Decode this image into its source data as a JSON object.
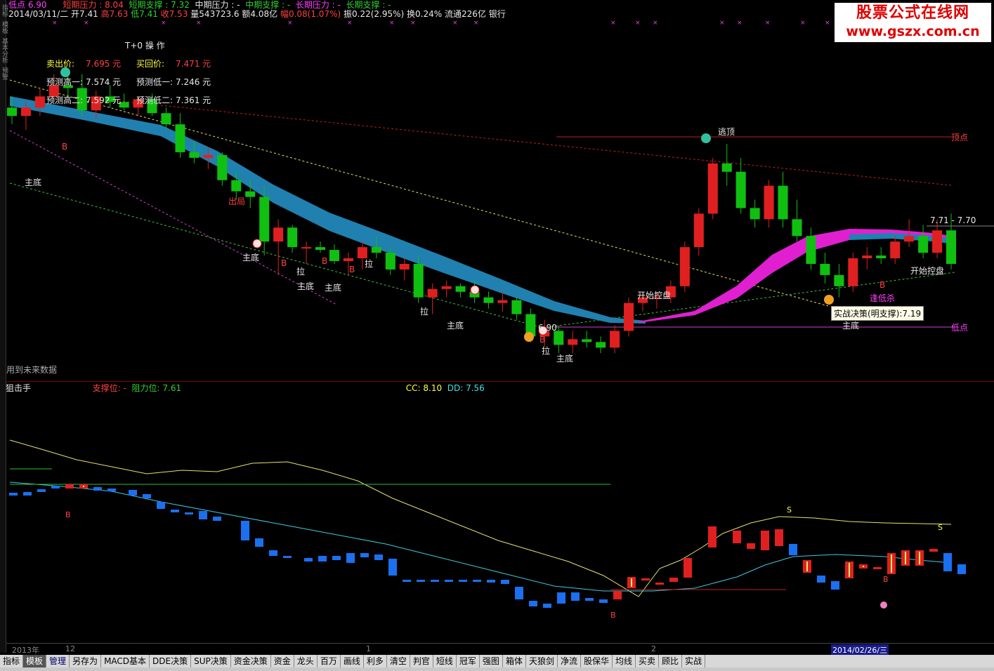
{
  "side": [
    "指标",
    "模板",
    "基本分析",
    "预警"
  ],
  "header1": {
    "lowpt": "低点 6.90",
    "short_res": "短期压力 : 8.04",
    "short_sup": "短期支撑 : 7.32",
    "mid_res": "中期压力 : -",
    "mid_sup": "中期支撑 : -",
    "long_res": "长期压力 : -",
    "long_sup": "长期支撑 : -"
  },
  "header2": {
    "date": "2014/03/11/二",
    "open": "开7.41",
    "high": "高7.63",
    "low": "低7.41",
    "close": "收7.53",
    "vol": "量543723.6",
    "amt": "额4.08亿",
    "chg": "幅0.08(1.07%)",
    "amp": "振0.22(2.95%)",
    "turn": "换0.24%",
    "float": "流通226亿",
    "sector": "银行"
  },
  "logo": {
    "line1": "股票公式在线网",
    "line2": "www.gszx.com.cn"
  },
  "tplus": {
    "title": "T+0 操 作",
    "sell": "卖出价:",
    "sell_v": "7.695 元",
    "buy": "买回价:",
    "buy_v": "7.471 元",
    "h1": "预测高一:",
    "h1_v": "7.574 元",
    "l1": "预测低一:",
    "l1_v": "7.246 元",
    "h2": "预测高二:",
    "h2_v": "7.592 元",
    "l2": "预测低二:",
    "l2_v": "7.361 元"
  },
  "annot": {
    "taoding": "逃顶",
    "dingdian": "顶点",
    "didian": "低点",
    "zhudi": "主底",
    "la": "拉",
    "chuju": "出局",
    "kpkp": "开始控盘",
    "fengdisha": "逢低杀",
    "future": "用到未来数据",
    "price_tag": "7.71 - 7.70",
    "low_v": "6.90",
    "b": "B",
    "s": "S"
  },
  "tooltip": "实战决策(明支撑):7.19",
  "lower": {
    "name": "狙击手",
    "support": "支撑位: -",
    "resist": "阻力位: 7.61",
    "cc": "CC: 8.10",
    "dd": "DD: 7.56"
  },
  "timeaxis": {
    "y2013": "2013年",
    "m12": "12",
    "m1": "1",
    "m2": "2",
    "sel": "2014/02/26/三"
  },
  "tabs": [
    "指标",
    "模板",
    "管理",
    "另存为",
    "MACD基本",
    "DDE决策",
    "SUP决策",
    "资金决策",
    "资金",
    "龙头",
    "百万",
    "画线",
    "利多",
    "清空",
    "判官",
    "短线",
    "冠军",
    "强图",
    "箱体",
    "天狼剑",
    "净流",
    "股保华",
    "均线",
    "买卖",
    "顾比",
    "实战"
  ],
  "chart_data": {
    "type": "candlestick",
    "title": "",
    "candles_ohlc": [
      [
        7.58,
        7.62,
        7.52,
        7.55
      ],
      [
        7.55,
        7.6,
        7.5,
        7.58
      ],
      [
        7.58,
        7.65,
        7.55,
        7.62
      ],
      [
        7.62,
        7.7,
        7.6,
        7.66
      ],
      [
        7.66,
        7.72,
        7.62,
        7.65
      ],
      [
        7.65,
        7.7,
        7.55,
        7.57
      ],
      [
        7.57,
        7.64,
        7.54,
        7.62
      ],
      [
        7.62,
        7.66,
        7.58,
        7.6
      ],
      [
        7.6,
        7.63,
        7.57,
        7.58
      ],
      [
        7.58,
        7.62,
        7.55,
        7.61
      ],
      [
        7.61,
        7.63,
        7.55,
        7.56
      ],
      [
        7.56,
        7.58,
        7.5,
        7.52
      ],
      [
        7.52,
        7.56,
        7.4,
        7.42
      ],
      [
        7.42,
        7.46,
        7.38,
        7.4
      ],
      [
        7.4,
        7.44,
        7.36,
        7.41
      ],
      [
        7.41,
        7.42,
        7.3,
        7.32
      ],
      [
        7.32,
        7.35,
        7.25,
        7.28
      ],
      [
        7.28,
        7.32,
        7.22,
        7.26
      ],
      [
        7.26,
        7.3,
        7.05,
        7.1
      ],
      [
        7.1,
        7.18,
        6.98,
        7.15
      ],
      [
        7.15,
        7.16,
        7.06,
        7.08
      ],
      [
        7.08,
        7.1,
        7.02,
        7.08
      ],
      [
        7.08,
        7.1,
        7.06,
        7.07
      ],
      [
        7.07,
        7.09,
        7.02,
        7.03
      ],
      [
        7.03,
        7.06,
        6.98,
        7.04
      ],
      [
        7.04,
        7.1,
        7.0,
        7.08
      ],
      [
        7.08,
        7.12,
        7.04,
        7.06
      ],
      [
        7.06,
        7.08,
        6.98,
        7.0
      ],
      [
        7.0,
        7.04,
        6.96,
        7.02
      ],
      [
        7.02,
        7.05,
        6.88,
        6.9
      ],
      [
        6.9,
        6.95,
        6.84,
        6.93
      ],
      [
        6.93,
        6.96,
        6.9,
        6.94
      ],
      [
        6.94,
        6.95,
        6.9,
        6.92
      ],
      [
        6.92,
        6.96,
        6.88,
        6.9
      ],
      [
        6.9,
        6.92,
        6.86,
        6.88
      ],
      [
        6.88,
        6.92,
        6.85,
        6.89
      ],
      [
        6.89,
        6.9,
        6.82,
        6.84
      ],
      [
        6.84,
        6.86,
        6.74,
        6.76
      ],
      [
        6.76,
        6.82,
        6.72,
        6.78
      ],
      [
        6.78,
        6.8,
        6.7,
        6.73
      ],
      [
        6.73,
        6.78,
        6.7,
        6.75
      ],
      [
        6.75,
        6.78,
        6.72,
        6.74
      ],
      [
        6.74,
        6.76,
        6.7,
        6.72
      ],
      [
        6.72,
        6.8,
        6.7,
        6.78
      ],
      [
        6.78,
        6.9,
        6.76,
        6.88
      ],
      [
        6.88,
        6.92,
        6.85,
        6.9
      ],
      [
        6.9,
        6.92,
        6.86,
        6.9
      ],
      [
        6.9,
        6.96,
        6.88,
        6.94
      ],
      [
        6.94,
        7.1,
        6.92,
        7.08
      ],
      [
        7.08,
        7.22,
        7.05,
        7.2
      ],
      [
        7.2,
        7.4,
        7.18,
        7.38
      ],
      [
        7.38,
        7.45,
        7.3,
        7.35
      ],
      [
        7.35,
        7.4,
        7.2,
        7.22
      ],
      [
        7.22,
        7.25,
        7.15,
        7.18
      ],
      [
        7.18,
        7.32,
        7.15,
        7.3
      ],
      [
        7.3,
        7.35,
        7.15,
        7.18
      ],
      [
        7.18,
        7.25,
        7.1,
        7.12
      ],
      [
        7.12,
        7.15,
        7.0,
        7.02
      ],
      [
        7.02,
        7.06,
        6.95,
        6.98
      ],
      [
        6.98,
        7.02,
        6.9,
        6.94
      ],
      [
        6.94,
        7.06,
        6.92,
        7.04
      ],
      [
        7.04,
        7.08,
        7.0,
        7.05
      ],
      [
        7.05,
        7.08,
        7.02,
        7.04
      ],
      [
        7.04,
        7.12,
        7.02,
        7.1
      ],
      [
        7.1,
        7.18,
        7.08,
        7.12
      ],
      [
        7.12,
        7.16,
        7.04,
        7.06
      ],
      [
        7.06,
        7.18,
        7.04,
        7.14
      ],
      [
        7.14,
        7.2,
        7.0,
        7.02
      ]
    ],
    "levels": {
      "top_line": 7.8,
      "low_line": 6.9,
      "price_tag": 7.7
    },
    "lower_panel": {
      "CC": 8.1,
      "DD": 7.56,
      "resistance": 7.61
    }
  }
}
